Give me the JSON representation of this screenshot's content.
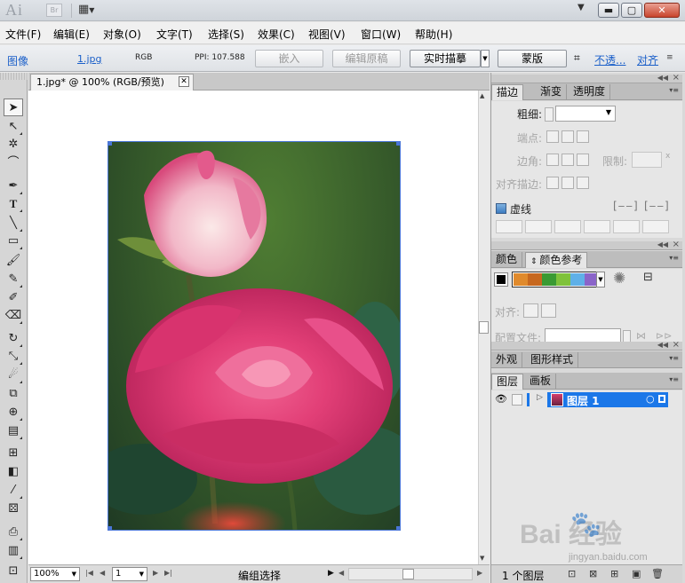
{
  "titlebar": {
    "logo": "Ai",
    "bridge": "Br",
    "window_buttons": [
      "minimize",
      "maximize",
      "close"
    ]
  },
  "menu": [
    "文件(F)",
    "编辑(E)",
    "对象(O)",
    "文字(T)",
    "选择(S)",
    "效果(C)",
    "视图(V)",
    "窗口(W)",
    "帮助(H)"
  ],
  "controlbar": {
    "type_label": "图像",
    "filename": "1.jpg",
    "color_mode": "RGB",
    "ppi": "PPI: 107.588",
    "embed_label": "嵌入",
    "edit_original_label": "编辑原稿",
    "live_trace_label": "实时描摹",
    "mask_label": "蒙版",
    "opacity_label": "不透...",
    "align_label": "对齐"
  },
  "document": {
    "tab_title": "1.jpg* @ 100% (RGB/预览)"
  },
  "statusbar": {
    "zoom": "100%",
    "artboard": "1",
    "status_text": "编组选择"
  },
  "panels": {
    "stroke": {
      "tabs": [
        "描边",
        "渐变",
        "透明度"
      ],
      "weight_label": "粗细:",
      "cap_label": "端点:",
      "corner_label": "边角:",
      "limit_label": "限制:",
      "limit_unit": "x",
      "align_stroke_label": "对齐描边:",
      "dashed_label": "虚线"
    },
    "color": {
      "tabs": [
        "颜色",
        "颜色参考"
      ],
      "guide_colors": [
        "#e08a2c",
        "#c7681f",
        "#3a9a33",
        "#7fc23b",
        "#5fb0e8",
        "#8a64c9"
      ],
      "align_label": "对齐:",
      "profile_label": "配置文件:"
    },
    "appearance": {
      "tabs": [
        "外观",
        "图形样式"
      ]
    },
    "layers": {
      "tabs": [
        "图层",
        "画板"
      ],
      "layer_name": "图层 1",
      "footer_count": "1 个图层"
    }
  },
  "watermark": {
    "brand": "Bai  经验",
    "url": "jingyan.baidu.com"
  }
}
